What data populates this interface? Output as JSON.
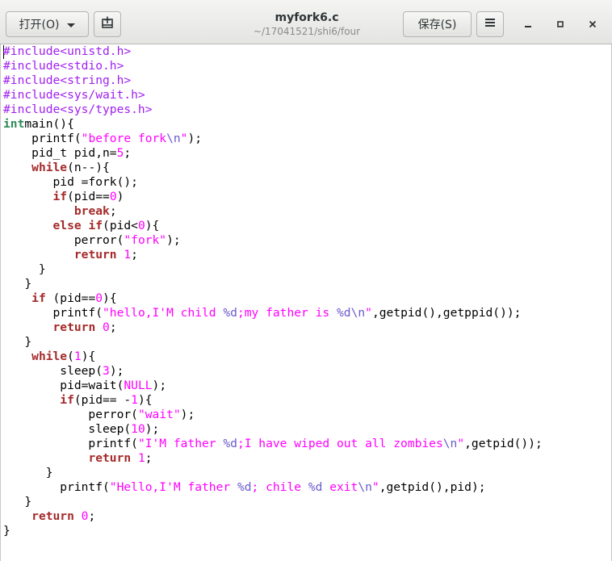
{
  "header": {
    "open_label": "打开(O)",
    "title": "myfork6.c",
    "subtitle": "~/17041521/shi6/four",
    "save_label": "保存(S)"
  },
  "icons": [
    "chevron-down-icon",
    "new-tab-icon",
    "hamburger-menu-icon",
    "minimize-icon",
    "maximize-icon",
    "close-icon"
  ],
  "syntax_colors": {
    "preprocessor": "#a020f0",
    "type": "#2e8b57",
    "keyword": "#a52a2a",
    "string": "#ff00ff",
    "number": "#ff00ff",
    "escape": "#6a5acd"
  },
  "code_lines": [
    [
      [
        "pp",
        "#include<unistd.h>"
      ]
    ],
    [
      [
        "pp",
        "#include<stdio.h>"
      ]
    ],
    [
      [
        "pp",
        "#include<string.h>"
      ]
    ],
    [
      [
        "pp",
        "#include<sys/wait.h>"
      ]
    ],
    [
      [
        "pp",
        "#include<sys/types.h>"
      ]
    ],
    [
      [
        "ty",
        "int"
      ],
      [
        "",
        "main(){"
      ]
    ],
    [
      [
        "",
        "    printf("
      ],
      [
        "st",
        "\"before fork"
      ],
      [
        "es",
        "\\n"
      ],
      [
        "st",
        "\""
      ],
      [
        "",
        ");"
      ]
    ],
    [
      [
        "",
        "    pid_t pid,n="
      ],
      [
        "nu",
        "5"
      ],
      [
        "",
        ";"
      ]
    ],
    [
      [
        "",
        "    "
      ],
      [
        "kw",
        "while"
      ],
      [
        "",
        "(n--){"
      ]
    ],
    [
      [
        "",
        "       pid =fork();"
      ]
    ],
    [
      [
        "",
        "       "
      ],
      [
        "kw",
        "if"
      ],
      [
        "",
        "(pid=="
      ],
      [
        "nu",
        "0"
      ],
      [
        "",
        ")"
      ]
    ],
    [
      [
        "",
        "          "
      ],
      [
        "kw",
        "break"
      ],
      [
        "",
        ";"
      ]
    ],
    [
      [
        "",
        "       "
      ],
      [
        "kw",
        "else if"
      ],
      [
        "",
        "(pid<"
      ],
      [
        "nu",
        "0"
      ],
      [
        "",
        "){"
      ]
    ],
    [
      [
        "",
        "          perror("
      ],
      [
        "st",
        "\"fork\""
      ],
      [
        "",
        ");"
      ]
    ],
    [
      [
        "",
        "          "
      ],
      [
        "kw",
        "return"
      ],
      [
        "nu",
        " 1"
      ],
      [
        "",
        ";"
      ]
    ],
    [
      [
        "",
        "     }"
      ]
    ],
    [
      [
        "",
        "   }"
      ]
    ],
    [
      [
        "",
        "    "
      ],
      [
        "kw",
        "if"
      ],
      [
        "",
        "",
        " (pid=="
      ],
      [
        "nu",
        "0"
      ],
      [
        "",
        "){"
      ]
    ],
    [
      [
        "",
        "       printf("
      ],
      [
        "st",
        "\"hello,I'M child "
      ],
      [
        "es",
        "%d"
      ],
      [
        "st",
        ";my father is "
      ],
      [
        "es",
        "%d"
      ],
      [
        "es",
        "\\n"
      ],
      [
        "st",
        "\""
      ],
      [
        "",
        ",getpid(),getppid());"
      ]
    ],
    [
      [
        "",
        "       "
      ],
      [
        "kw",
        "return"
      ],
      [
        "nu",
        " 0"
      ],
      [
        "",
        ";"
      ]
    ],
    [
      [
        "",
        "   }"
      ]
    ],
    [
      [
        "",
        "    "
      ],
      [
        "kw",
        "while"
      ],
      [
        "",
        "("
      ],
      [
        "nu",
        "1"
      ],
      [
        "",
        "){"
      ]
    ],
    [
      [
        "",
        "        sleep("
      ],
      [
        "nu",
        "3"
      ],
      [
        "",
        ");"
      ]
    ],
    [
      [
        "",
        "        pid=wait("
      ],
      [
        "nu",
        "NULL"
      ],
      [
        "",
        ");"
      ]
    ],
    [
      [
        "",
        "        "
      ],
      [
        "kw",
        "if"
      ],
      [
        "",
        "(pid== -"
      ],
      [
        "nu",
        "1"
      ],
      [
        "",
        "){"
      ]
    ],
    [
      [
        "",
        "            perror("
      ],
      [
        "st",
        "\"wait\""
      ],
      [
        "",
        ");"
      ]
    ],
    [
      [
        "",
        "            sleep("
      ],
      [
        "nu",
        "10"
      ],
      [
        "",
        ");"
      ]
    ],
    [
      [
        "",
        "            printf("
      ],
      [
        "st",
        "\"I'M father "
      ],
      [
        "es",
        "%d"
      ],
      [
        "st",
        ";I have wiped out all zombies"
      ],
      [
        "es",
        "\\n"
      ],
      [
        "st",
        "\""
      ],
      [
        "",
        ",getpid());"
      ]
    ],
    [
      [
        "",
        "            "
      ],
      [
        "kw",
        "return"
      ],
      [
        "nu",
        " 1"
      ],
      [
        "",
        ";"
      ]
    ],
    [
      [
        "",
        "      }"
      ]
    ],
    [
      [
        "",
        "        printf("
      ],
      [
        "st",
        "\"Hello,I'M father "
      ],
      [
        "es",
        "%d"
      ],
      [
        "st",
        "; chile "
      ],
      [
        "es",
        "%d"
      ],
      [
        "st",
        " exit"
      ],
      [
        "es",
        "\\n"
      ],
      [
        "st",
        "\""
      ],
      [
        "",
        ",getpid(),pid);"
      ]
    ],
    [
      [
        "",
        "   }"
      ]
    ],
    [
      [
        "",
        "    "
      ],
      [
        "kw",
        "return"
      ],
      [
        "nu",
        " 0"
      ],
      [
        "",
        ";"
      ]
    ],
    [
      [
        "",
        "}"
      ]
    ]
  ]
}
